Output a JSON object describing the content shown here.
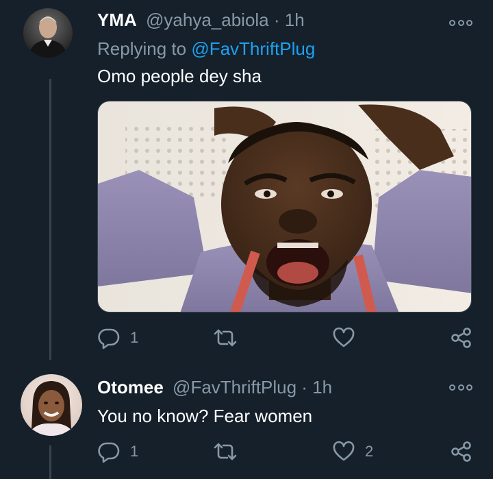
{
  "tweets": [
    {
      "name": "YMA",
      "handle": "@yahya_abiola",
      "dot": "·",
      "time": "1h",
      "replying_prefix": "Replying to",
      "replying_handle": "@FavThriftPlug",
      "text": "Omo people dey sha",
      "media_description": "reaction-photo",
      "replies": "1",
      "retweets": "",
      "likes": "",
      "icons": [
        "reply-icon",
        "retweet-icon",
        "like-icon",
        "share-icon",
        "more-icon"
      ]
    },
    {
      "name": "Otomee",
      "handle": "@FavThriftPlug",
      "dot": "·",
      "time": "1h",
      "text": "You no know? Fear women",
      "replies": "1",
      "retweets": "",
      "likes": "2",
      "icons": [
        "reply-icon",
        "retweet-icon",
        "like-icon",
        "share-icon",
        "more-icon"
      ]
    }
  ],
  "colors": {
    "background": "#15202b",
    "text_primary": "#ffffff",
    "text_secondary": "#8899a6",
    "accent_link": "#1da1f2",
    "divider": "#38444d"
  }
}
